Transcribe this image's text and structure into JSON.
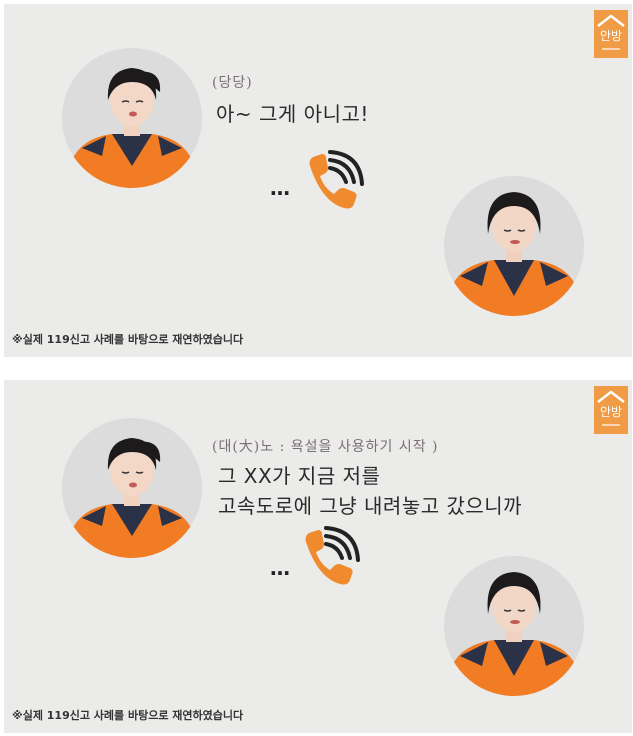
{
  "panels": [
    {
      "logo_text": "안방",
      "note": "(당당)",
      "lines": [
        "아~ 그게 아니고!"
      ],
      "ellipsis": "…",
      "footer": "※실제 119신고 사례를 바탕으로 재연하였습니다",
      "icons": {
        "phone": "ringing-phone-icon"
      }
    },
    {
      "logo_text": "안방",
      "note": "(대(大)노 : 욕설을 사용하기 시작 )",
      "lines": [
        "그 XX가 지금 저를",
        "고속도로에 그냥 내려놓고 갔으니까"
      ],
      "ellipsis": "…",
      "footer": "※실제 119신고 사례를 바탕으로 재연하였습니다",
      "icons": {
        "phone": "ringing-phone-icon"
      }
    }
  ],
  "colors": {
    "background": "#ebebea",
    "logo": "#f09b45",
    "phone": "#f08a2f",
    "uniform_orange": "#f17c24",
    "uniform_navy": "#2b3147"
  }
}
